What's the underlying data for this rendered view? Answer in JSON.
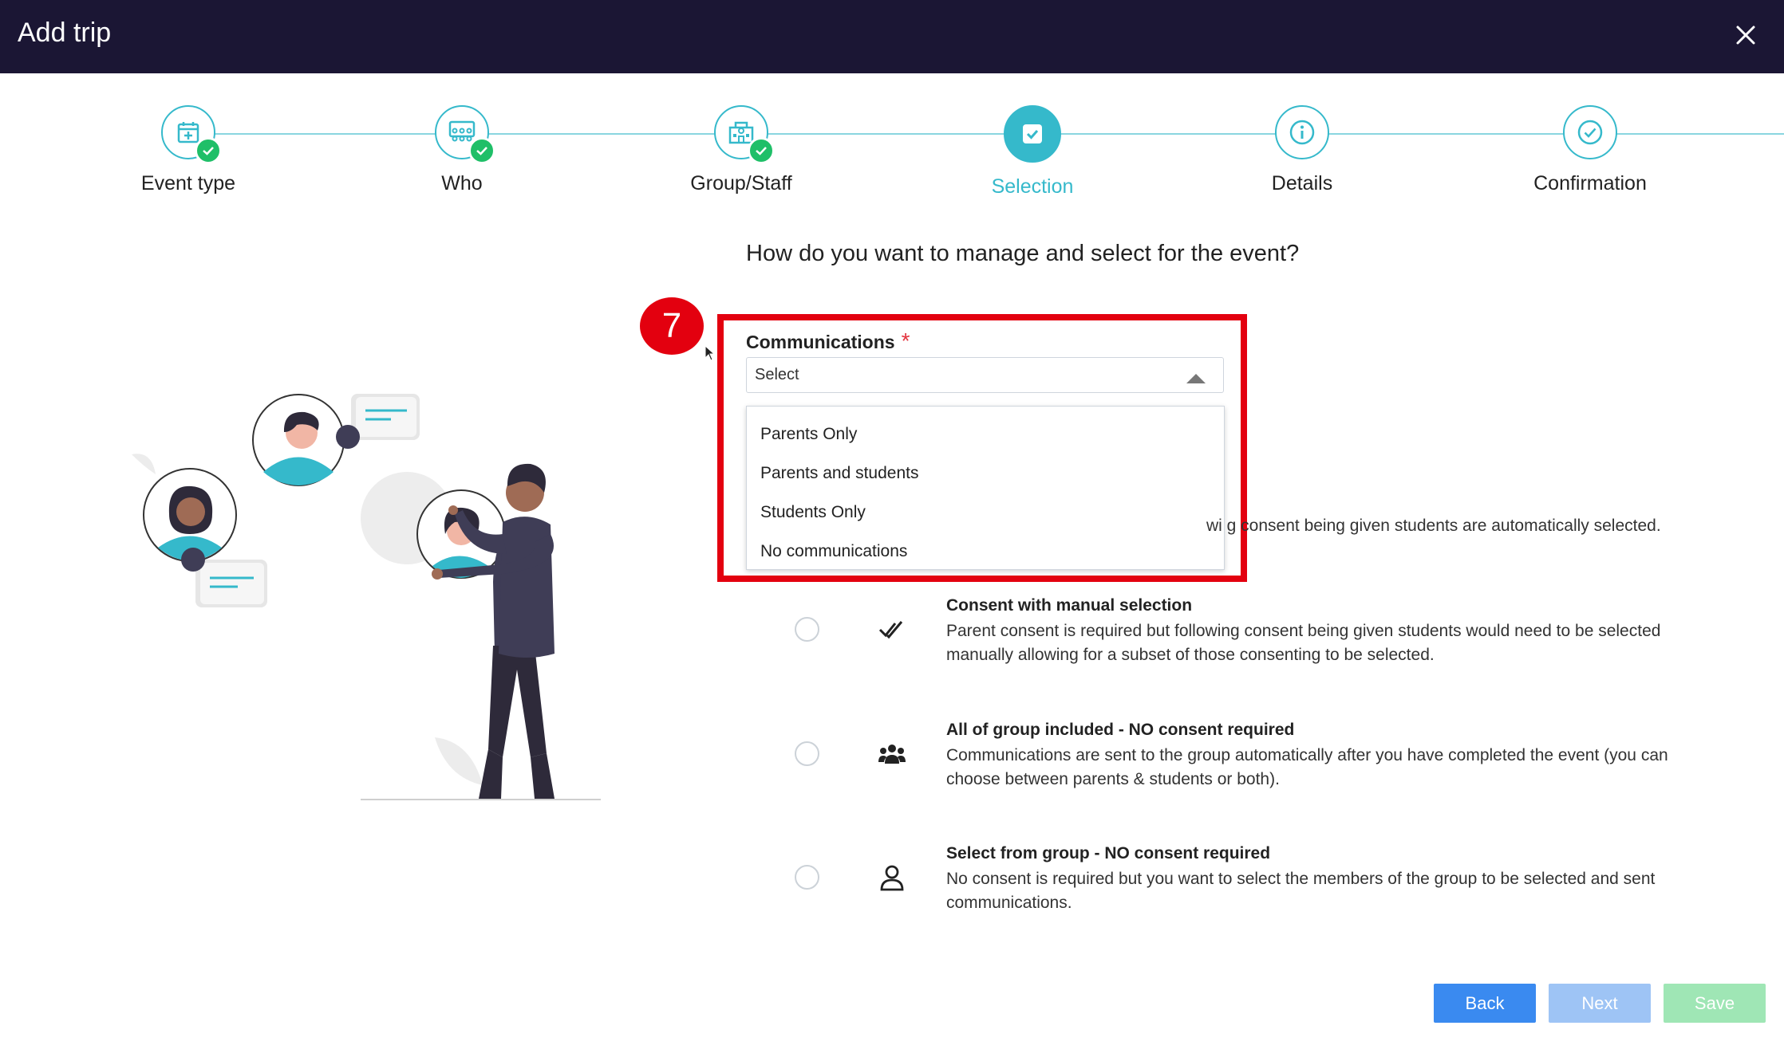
{
  "header": {
    "title": "Add trip"
  },
  "stepper": {
    "steps": [
      {
        "label": "Event type",
        "icon": "calendar-plus-icon",
        "completed": true
      },
      {
        "label": "Who",
        "icon": "group-icon",
        "completed": true
      },
      {
        "label": "Group/Staff",
        "icon": "school-building-icon",
        "completed": true
      },
      {
        "label": "Selection",
        "icon": "checkbox-icon",
        "active": true
      },
      {
        "label": "Details",
        "icon": "info-icon"
      },
      {
        "label": "Confirmation",
        "icon": "check-circle-icon"
      }
    ]
  },
  "main": {
    "question": "How do you want to manage and select for the event?",
    "annotation_number": "7",
    "communications": {
      "label": "Communications",
      "required_marker": "*",
      "selected": "Select",
      "options": [
        "Parents Only",
        "Parents and students",
        "Students Only",
        "No communications"
      ]
    },
    "partial_hint": "wi g consent being given students are automatically selected.",
    "consent_options": [
      {
        "title": "Consent with manual selection",
        "description": "Parent consent is required but following consent being given students would need to be selected manually allowing for a subset of those consenting to be selected.",
        "icon": "double-check-icon"
      },
      {
        "title": "All of group included - NO consent required",
        "description": "Communications are sent to the group automatically after you have completed the event (you can choose between parents & students or both).",
        "icon": "people-group-icon"
      },
      {
        "title": "Select from group - NO consent required",
        "description": "No consent is required but you want to select the members of the group to be selected and sent communications.",
        "icon": "person-icon"
      }
    ]
  },
  "footer": {
    "back_label": "Back",
    "next_label": "Next",
    "save_label": "Save"
  },
  "colors": {
    "header_bg": "#1b1634",
    "accent": "#35b9cb",
    "success": "#1fbf68",
    "highlight": "#e3000f",
    "button_back": "#3a8af0",
    "button_next": "#9ec4f5",
    "button_save": "#9fe6b5"
  }
}
